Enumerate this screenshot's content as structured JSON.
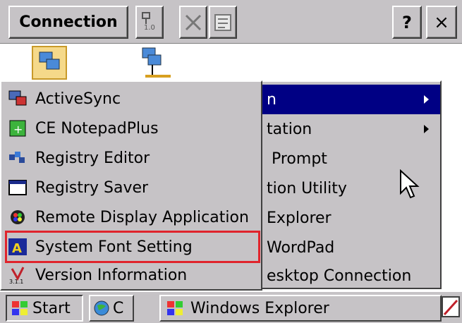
{
  "window": {
    "title_button": "Connection",
    "help_label": "?",
    "close_label": "×"
  },
  "programs_menu": {
    "items": [
      {
        "label": "ActiveSync",
        "icon": "activesync-icon"
      },
      {
        "label": "CE NotepadPlus",
        "icon": "notepad-icon"
      },
      {
        "label": "Registry Editor",
        "icon": "registry-editor-icon"
      },
      {
        "label": "Registry Saver",
        "icon": "registry-saver-icon"
      },
      {
        "label": "Remote Display Application",
        "icon": "remote-display-icon"
      },
      {
        "label": "System Font Setting",
        "icon": "font-setting-icon",
        "highlighted": true
      },
      {
        "label": "Version Information",
        "icon": "version-info-icon"
      }
    ]
  },
  "secondary_menu": {
    "items": [
      {
        "label": "n",
        "selected": true,
        "submenu": true
      },
      {
        "label": "tation",
        "submenu": true
      },
      {
        "label": " Prompt"
      },
      {
        "label": "tion Utility"
      },
      {
        "label": "Explorer"
      },
      {
        "label": "WordPad"
      },
      {
        "label": "esktop Connection"
      }
    ]
  },
  "taskbar": {
    "start_label": "Start",
    "control_panel_label": "C",
    "explorer_label": "Windows Explorer"
  },
  "colors": {
    "menu_bg": "#c6c3c6",
    "selection_bg": "#000084",
    "highlight_outline": "#e0242c"
  }
}
